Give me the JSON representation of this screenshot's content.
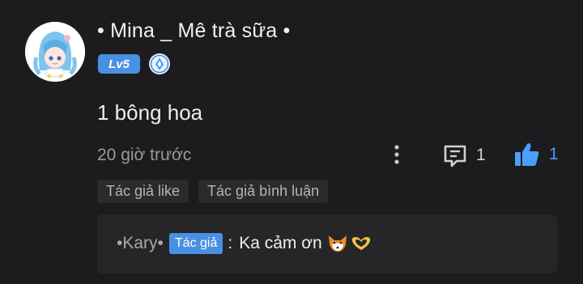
{
  "comment": {
    "username": "• Mina _ Mê trà sữa •",
    "level_badge": "Lv5",
    "content": "1 bông hoa",
    "time": "20 giờ trước",
    "comment_count": "1",
    "like_count": "1",
    "tags": [
      "Tác giả like",
      "Tác giả bình luận"
    ]
  },
  "reply": {
    "author": "•Kary•",
    "author_tag": "Tác giả",
    "separator": ":",
    "text": "Ka cảm ơn",
    "emojis": [
      "fox-face-icon",
      "heart-hands-icon"
    ]
  },
  "colors": {
    "background": "#1c1c1e",
    "accent": "#4a90e2",
    "like": "#4a9eff",
    "muted_text": "#9a9a9a",
    "tag_background": "#2b2b2d",
    "reply_background": "#262628"
  }
}
